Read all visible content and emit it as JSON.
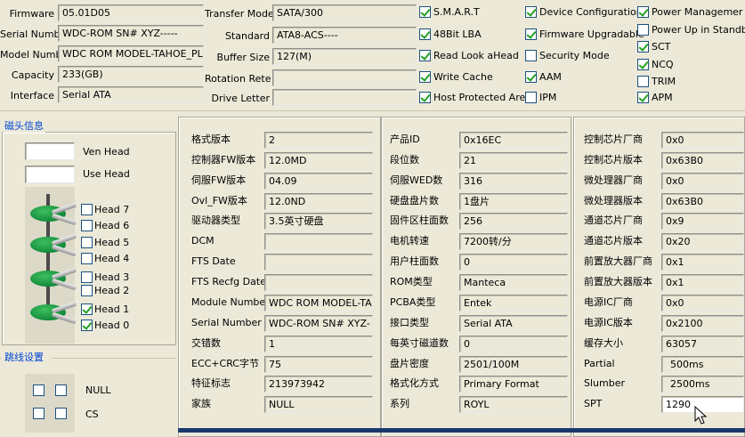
{
  "top": {
    "firmware": {
      "label": "Firmware",
      "value": "05.01D05"
    },
    "serial": {
      "label": "Serial Number",
      "value": "WDC-ROM SN# XYZ-----"
    },
    "model": {
      "label": "Model Number",
      "value": "WDC ROM MODEL-TAHOE_PL-"
    },
    "capacity": {
      "label": "Capacity",
      "value": "233(GB)"
    },
    "interface": {
      "label": "Interface",
      "value": "Serial ATA"
    },
    "transfer_mode": {
      "label": "Transfer Mode",
      "value": "SATA/300"
    },
    "standard": {
      "label": "Standard",
      "value": "ATA8-ACS----"
    },
    "buffer_size": {
      "label": "Buffer Size",
      "value": "127(M)"
    },
    "rotation_rate": {
      "label": "Rotation Rete",
      "value": ""
    },
    "drive_letter": {
      "label": "Drive Letter",
      "value": ""
    }
  },
  "features_col1": [
    {
      "label": "S.M.A.R.T",
      "checked": true
    },
    {
      "label": "48Bit LBA",
      "checked": true
    },
    {
      "label": "Read Look aHead",
      "checked": true
    },
    {
      "label": "Write Cache",
      "checked": true
    },
    {
      "label": "Host Protected Area",
      "checked": true
    }
  ],
  "features_col2": [
    {
      "label": "Device Configuration",
      "checked": true
    },
    {
      "label": "Firmware Upgradable",
      "checked": true
    },
    {
      "label": "Security Mode",
      "checked": false
    },
    {
      "label": "AAM",
      "checked": true
    },
    {
      "label": "IPM",
      "checked": false
    }
  ],
  "features_col3": [
    {
      "label": "Power Managemer",
      "checked": true
    },
    {
      "label": "Power Up in Standby",
      "checked": false
    },
    {
      "label": "SCT",
      "checked": true
    },
    {
      "label": "NCQ",
      "checked": true
    },
    {
      "label": "TRIM",
      "checked": false
    },
    {
      "label": "APM",
      "checked": true
    }
  ],
  "heads_group": {
    "title": "磁头信息",
    "ven_head_label": "Ven Head",
    "use_head_label": "Use Head",
    "heads": [
      {
        "label": "Head 7",
        "checked": false
      },
      {
        "label": "Head 6",
        "checked": false
      },
      {
        "label": "Head 5",
        "checked": false
      },
      {
        "label": "Head 4",
        "checked": false
      },
      {
        "label": "Head 3",
        "checked": false
      },
      {
        "label": "Head 2",
        "checked": false
      },
      {
        "label": "Head 1",
        "checked": true
      },
      {
        "label": "Head 0",
        "checked": true
      }
    ]
  },
  "jumper_group": {
    "title": "跳线设置",
    "rows": [
      {
        "label": "NULL"
      },
      {
        "label": "CS"
      }
    ]
  },
  "col_a": [
    {
      "label": "格式版本",
      "value": "2"
    },
    {
      "label": "控制器FW版本",
      "value": "12.0MD"
    },
    {
      "label": "伺服FW版本",
      "value": "04.09"
    },
    {
      "label": "Ovl_FW版本",
      "value": "12.0ND"
    },
    {
      "label": "驱动器类型",
      "value": "3.5英寸硬盘"
    },
    {
      "label": "DCM",
      "value": ""
    },
    {
      "label": "FTS Date",
      "value": ""
    },
    {
      "label": "FTS Recfg Date",
      "value": ""
    },
    {
      "label": "Module Number",
      "value": "WDC ROM MODEL-TAHC"
    },
    {
      "label": "Serial Number",
      "value": "WDC-ROM SN# XYZ-"
    },
    {
      "label": "交错数",
      "value": "1"
    },
    {
      "label": "ECC+CRC字节",
      "value": "75"
    },
    {
      "label": "特征标志",
      "value": "213973942"
    },
    {
      "label": "家族",
      "value": "NULL"
    }
  ],
  "col_b": [
    {
      "label": "产品ID",
      "value": "0x16EC"
    },
    {
      "label": "段位数",
      "value": "21"
    },
    {
      "label": "伺服WED数",
      "value": "316"
    },
    {
      "label": "硬盘盘片数",
      "value": "1盘片"
    },
    {
      "label": "固件区柱面数",
      "value": "256"
    },
    {
      "label": "电机转速",
      "value": "7200转/分"
    },
    {
      "label": "用户柱面数",
      "value": "0"
    },
    {
      "label": "ROM类型",
      "value": "Manteca"
    },
    {
      "label": "PCBA类型",
      "value": "Entek"
    },
    {
      "label": "接口类型",
      "value": "Serial ATA"
    },
    {
      "label": "每英寸磁道数",
      "value": "0"
    },
    {
      "label": "盘片密度",
      "value": "2501/100M"
    },
    {
      "label": "格式化方式",
      "value": "Primary Format"
    },
    {
      "label": "系列",
      "value": "ROYL"
    }
  ],
  "col_c": [
    {
      "label": "控制芯片厂商",
      "value": "0x0"
    },
    {
      "label": "控制芯片版本",
      "value": "0x63B0"
    },
    {
      "label": "微处理器厂商",
      "value": "0x0"
    },
    {
      "label": "微处理器版本",
      "value": "0x63B0"
    },
    {
      "label": "通道芯片厂商",
      "value": "0x9"
    },
    {
      "label": "通道芯片版本",
      "value": "0x20"
    },
    {
      "label": "前置放大器厂商",
      "value": "0x1"
    },
    {
      "label": "前置放大器版本",
      "value": "0x1"
    },
    {
      "label": "电源IC厂商",
      "value": "0x0"
    },
    {
      "label": "电源IC版本",
      "value": "0x2100"
    },
    {
      "label": "缓存大小",
      "value": "63057"
    },
    {
      "label": "Partial",
      "value": "500ms"
    },
    {
      "label": "Slumber",
      "value": "2500ms"
    },
    {
      "label": "SPT",
      "value": "1290"
    }
  ]
}
